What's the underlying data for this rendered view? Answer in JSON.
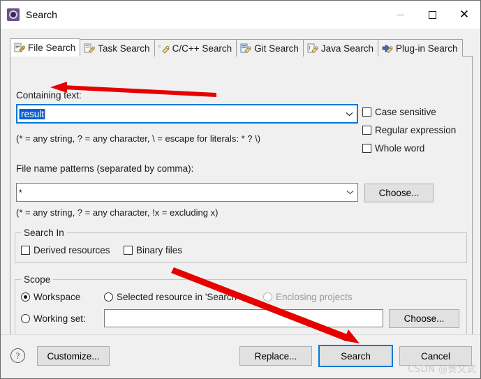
{
  "window": {
    "title": "Search",
    "icon": "search-app-icon",
    "controls": {
      "minimize": "–",
      "maximize": "□",
      "close": "✕"
    }
  },
  "tabs": [
    {
      "label": "File Search",
      "icon": "file-search-icon",
      "active": true
    },
    {
      "label": "Task Search",
      "icon": "task-search-icon",
      "active": false
    },
    {
      "label": "C/C++ Search",
      "icon": "cpp-search-icon",
      "active": false
    },
    {
      "label": "Git Search",
      "icon": "git-search-icon",
      "active": false
    },
    {
      "label": "Java Search",
      "icon": "java-search-icon",
      "active": false
    },
    {
      "label": "Plug-in Search",
      "icon": "plugin-search-icon",
      "active": false
    }
  ],
  "form": {
    "containing_text_label": "Containing text:",
    "containing_text_value": "result",
    "containing_text_hint": "(* = any string, ? = any character, \\ = escape for literals: * ? \\)",
    "file_patterns_label": "File name patterns (separated by comma):",
    "file_patterns_value": "*",
    "file_patterns_hint": "(* = any string, ? = any character, !x = excluding x)",
    "choose_patterns_label": "Choose...",
    "options": [
      {
        "label": "Case sensitive",
        "checked": false
      },
      {
        "label": "Regular expression",
        "checked": false
      },
      {
        "label": "Whole word",
        "checked": false
      }
    ]
  },
  "search_in": {
    "title": "Search In",
    "items": [
      {
        "label": "Derived resources",
        "checked": false
      },
      {
        "label": "Binary files",
        "checked": false
      }
    ]
  },
  "scope": {
    "title": "Scope",
    "radios": [
      {
        "label": "Workspace",
        "checked": true,
        "disabled": false
      },
      {
        "label": "Selected resource in 'Search'",
        "checked": false,
        "disabled": false
      },
      {
        "label": "Enclosing projects",
        "checked": false,
        "disabled": true
      },
      {
        "label": "Working set:",
        "checked": false,
        "disabled": false
      }
    ],
    "working_set_value": "",
    "choose_label": "Choose..."
  },
  "buttonbar": {
    "help_icon": "?",
    "customize_label": "Customize...",
    "replace_label": "Replace...",
    "search_label": "Search",
    "cancel_label": "Cancel"
  },
  "watermark": "CSDN @赞文武",
  "colors": {
    "accent": "#0078d7",
    "selection": "#0a5fd4",
    "annotation": "#e60000",
    "dialog_bg": "#f0f0f0",
    "field_bg": "#ffffff"
  }
}
